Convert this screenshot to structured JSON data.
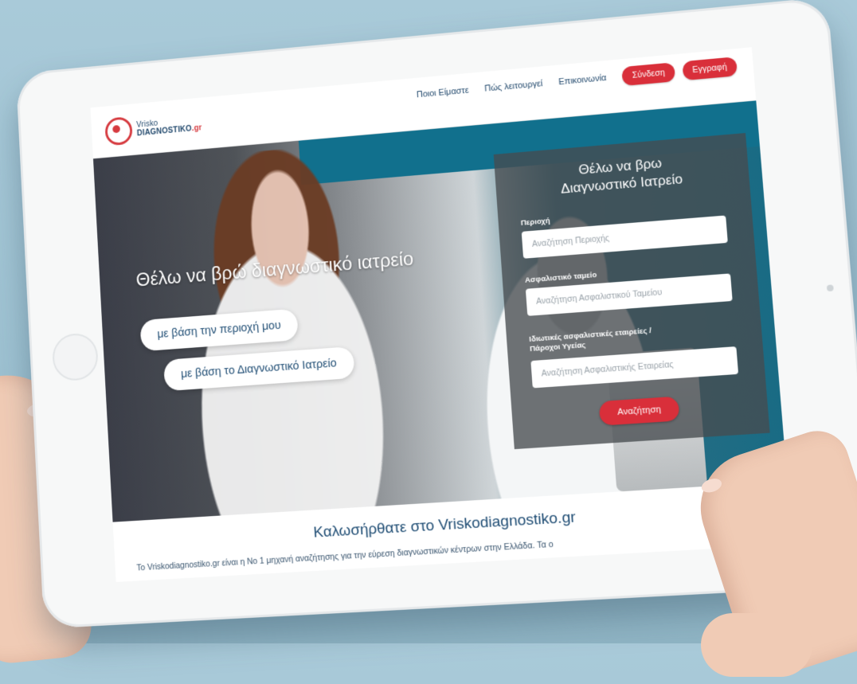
{
  "brand": {
    "logo_line1": "Vrisko",
    "logo_line2": "DIAGNOSTIKO",
    "logo_tld": ".gr"
  },
  "nav": {
    "links": [
      "Ποιοι Είμαστε",
      "Πώς λειτουργεί",
      "Επικοινωνία"
    ],
    "login_label": "Σύνδεση",
    "register_label": "Εγγραφή"
  },
  "hero": {
    "title": "Θέλω να βρώ διαγνωστικό ιατρείο",
    "option_area": "με βάση την περιοχή μου",
    "option_clinic": "με βάση το Διαγνωστικό Ιατρείο"
  },
  "search_panel": {
    "title_line1": "Θέλω να βρω",
    "title_line2": "Διαγνωστικό Ιατρείο",
    "area_label": "Περιοχή",
    "area_placeholder": "Αναζήτηση Περιοχής",
    "insurance_label": "Ασφαλιστικό ταμείο",
    "insurance_placeholder": "Αναζήτηση Ασφαλιστικού Ταμείου",
    "private_label_line1": "Ιδιωτικές ασφαλιστικές εταιρείες /",
    "private_label_line2": "Πάροχοι Υγείας",
    "private_placeholder": "Αναζήτηση Ασφαλιστικής Εταιρείας",
    "search_button": "Αναζήτηση"
  },
  "welcome": {
    "heading": "Καλωσήρθατε στο Vriskodiagnostiko.gr",
    "body": "Το Vriskodiagnostiko.gr είναι η Νο 1 μηχανή αναζήτησης για την εύρεση διαγνωστικών κέντρων στην Ελλάδα. Τα ο"
  }
}
